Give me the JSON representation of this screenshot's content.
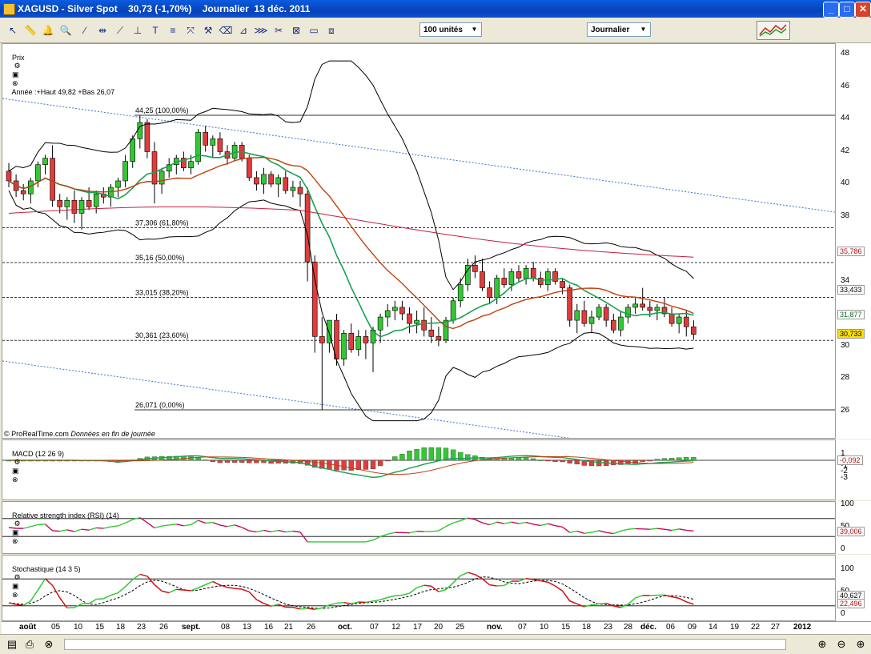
{
  "window": {
    "title": "XAGUSD - Silver Spot    30,73 (-1,70%)    Journalier  13 déc. 2011",
    "controls": {
      "minimize": "_",
      "maximize": "□",
      "close": "✕"
    }
  },
  "toolbar": {
    "tools": [
      "cursor-icon",
      "ruler-icon",
      "bell-icon",
      "zoom-icon",
      "line-icon",
      "horizontal-line-icon",
      "trendline-icon",
      "vertical-line-icon",
      "text-icon",
      "fibonacci-icon",
      "arrows-icon",
      "hammer-icon",
      "trash-icon",
      "fibonacci-fan-icon",
      "fibonacci-channel-icon",
      "scissors-icon",
      "gann-icon",
      "rectangle-icon",
      "channel-icon"
    ],
    "units_select": "100 unités",
    "period_select": "Journalier"
  },
  "price_panel": {
    "label": "Prix",
    "info": "Année :+Haut 49,82 +Bas 26,07",
    "fib_levels": [
      {
        "label": "44,25 (100,00%)",
        "price": 44.25,
        "style": "solid"
      },
      {
        "label": "37,306 (61,80%)",
        "price": 37.306,
        "style": "dashed"
      },
      {
        "label": "35,16 (50,00%)",
        "price": 35.16,
        "style": "dashed"
      },
      {
        "label": "33,015 (38,20%)",
        "price": 33.015,
        "style": "dashed"
      },
      {
        "label": "30,361 (23,60%)",
        "price": 30.361,
        "style": "dashed"
      },
      {
        "label": "26,071 (0,00%)",
        "price": 26.071,
        "style": "solid"
      }
    ],
    "footer_brand": "© ProRealTime.com",
    "footer_note": "Données en fin de journée",
    "y_ticks": [
      "48",
      "46",
      "44",
      "42",
      "40",
      "38",
      "34",
      "30",
      "28",
      "26"
    ],
    "tags": [
      {
        "text": "35,786",
        "color": "#b01010"
      },
      {
        "text": "33,433",
        "color": "#000000"
      },
      {
        "text": "31,877",
        "color": "#0a6a20"
      },
      {
        "text": "30,733",
        "color": "#000000",
        "bg": "#ffe000"
      }
    ]
  },
  "macd_panel": {
    "label": "MACD (12 26 9)",
    "y_ticks": [
      "1",
      "-1",
      "-2",
      "-3"
    ],
    "tag": "-0,092"
  },
  "rsi_panel": {
    "label": "Relative strength index (RSI) (14)",
    "y_ticks": [
      "100",
      "50",
      "0"
    ],
    "tag": "39,006"
  },
  "stoch_panel": {
    "label": "Stochastique (14 3 5)",
    "y_ticks": [
      "100",
      "50",
      "0"
    ],
    "tags": [
      {
        "text": "40,627"
      },
      {
        "text": "22,496"
      }
    ]
  },
  "x_axis": {
    "ticks": [
      {
        "t": "août",
        "bold": true
      },
      {
        "t": "05"
      },
      {
        "t": "10"
      },
      {
        "t": "15"
      },
      {
        "t": "18"
      },
      {
        "t": "23"
      },
      {
        "t": "26"
      },
      {
        "t": "sept.",
        "bold": true
      },
      {
        "t": "08"
      },
      {
        "t": "13"
      },
      {
        "t": "16"
      },
      {
        "t": "21"
      },
      {
        "t": "26"
      },
      {
        "t": "oct.",
        "bold": true
      },
      {
        "t": "07"
      },
      {
        "t": "12"
      },
      {
        "t": "17"
      },
      {
        "t": "20"
      },
      {
        "t": "25"
      },
      {
        "t": "nov.",
        "bold": true
      },
      {
        "t": "07"
      },
      {
        "t": "10"
      },
      {
        "t": "15"
      },
      {
        "t": "18"
      },
      {
        "t": "23"
      },
      {
        "t": "28"
      },
      {
        "t": "déc.",
        "bold": true
      },
      {
        "t": "06"
      },
      {
        "t": "09"
      },
      {
        "t": "14"
      },
      {
        "t": "19"
      },
      {
        "t": "22"
      },
      {
        "t": "27"
      },
      {
        "t": "2012",
        "bold": true
      }
    ]
  },
  "colors": {
    "up": "#32c832",
    "down": "#e03c3c",
    "ma_green": "#1aa050",
    "ma_brown": "#c04010",
    "ma_red": "#c02040",
    "bollinger": "#000000"
  }
}
